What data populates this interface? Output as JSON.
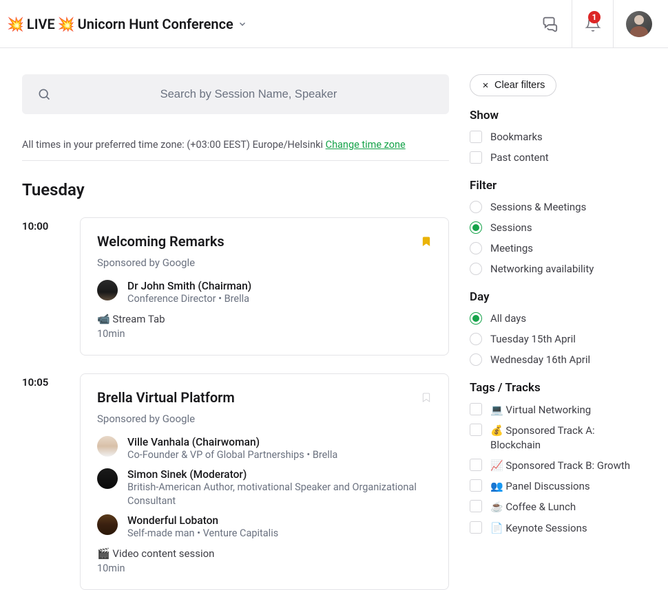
{
  "header": {
    "emoji1": "💥",
    "live": "LIVE",
    "emoji2": "💥",
    "title": "Unicorn Hunt Conference",
    "notification_count": "1"
  },
  "search": {
    "placeholder": "Search by Session Name, Speaker"
  },
  "timezone": {
    "prefix": "All times in your preferred time zone:",
    "value": "(+03:00 EEST) Europe/Helsinki",
    "link": "Change time zone"
  },
  "schedule": {
    "day_label": "Tuesday",
    "slots": [
      {
        "time": "10:00",
        "title": "Welcoming Remarks",
        "sponsor": "Sponsored by Google",
        "bookmarked": true,
        "people": [
          {
            "name": "Dr John Smith (Chairman)",
            "role": "Conference Director • Brella"
          }
        ],
        "type_icon": "📹",
        "type_label": "Stream Tab",
        "duration": "10min"
      },
      {
        "time": "10:05",
        "title": "Brella Virtual Platform",
        "sponsor": "Sponsored by Google",
        "bookmarked": false,
        "people": [
          {
            "name": "Ville Vanhala (Chairwoman)",
            "role": "Co-Founder & VP of Global Partnerships • Brella"
          },
          {
            "name": "Simon Sinek (Moderator)",
            "role": "British-American Author, motivational Speaker and Organizational Consultant"
          },
          {
            "name": "Wonderful Lobaton",
            "role": "Self-made man • Venture Capitalis"
          }
        ],
        "type_icon": "🎬",
        "type_label": "Video content session",
        "duration": "10min"
      }
    ]
  },
  "sidebar": {
    "clear_label": "Clear filters",
    "show": {
      "title": "Show",
      "options": [
        {
          "label": "Bookmarks"
        },
        {
          "label": "Past content"
        }
      ]
    },
    "filter": {
      "title": "Filter",
      "options": [
        {
          "label": "Sessions & Meetings",
          "selected": false
        },
        {
          "label": "Sessions",
          "selected": true
        },
        {
          "label": "Meetings",
          "selected": false
        },
        {
          "label": "Networking availability",
          "selected": false
        }
      ]
    },
    "day": {
      "title": "Day",
      "options": [
        {
          "label": "All days",
          "selected": true
        },
        {
          "label": "Tuesday 15th April",
          "selected": false
        },
        {
          "label": "Wednesday 16th April",
          "selected": false
        }
      ]
    },
    "tags": {
      "title": "Tags / Tracks",
      "options": [
        {
          "icon": "💻",
          "label": "Virtual Networking"
        },
        {
          "icon": "💰",
          "label": "Sponsored Track A: Blockchain"
        },
        {
          "icon": "📈",
          "label": "Sponsored Track B: Growth"
        },
        {
          "icon": "👥",
          "label": "Panel Discussions"
        },
        {
          "icon": "☕",
          "label": "Coffee & Lunch"
        },
        {
          "icon": "📄",
          "label": "Keynote Sessions"
        }
      ]
    }
  }
}
